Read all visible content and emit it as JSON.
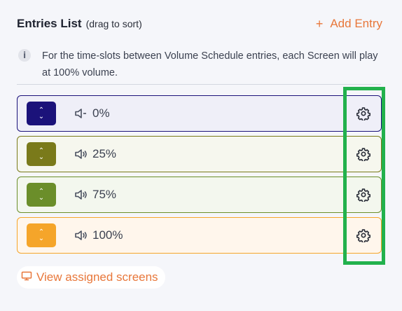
{
  "header": {
    "title": "Entries List",
    "subtitle": "(drag to sort)",
    "add_label": "Add Entry",
    "add_icon": "+"
  },
  "info": {
    "icon": "i",
    "text": "For the time-slots between Volume Schedule entries, each Screen will play at 100% volume."
  },
  "entries": [
    {
      "label": "0%",
      "icon": "volume-muted-icon",
      "color": "#1b127a",
      "bg": "#efeff8",
      "border": "#1b127a"
    },
    {
      "label": "25%",
      "icon": "volume-icon",
      "color": "#7a7a1a",
      "bg": "#f6f7ee",
      "border": "#7a7a1a"
    },
    {
      "label": "75%",
      "icon": "volume-icon",
      "color": "#6b8e2a",
      "bg": "#f3f7ee",
      "border": "#6b8e2a"
    },
    {
      "label": "100%",
      "icon": "volume-icon",
      "color": "#f5a52a",
      "bg": "#fff6ec",
      "border": "#f5a52a"
    }
  ],
  "footer": {
    "view_label": "View assigned screens"
  },
  "colors": {
    "accent": "#e8773a",
    "highlight": "#22b14c"
  }
}
